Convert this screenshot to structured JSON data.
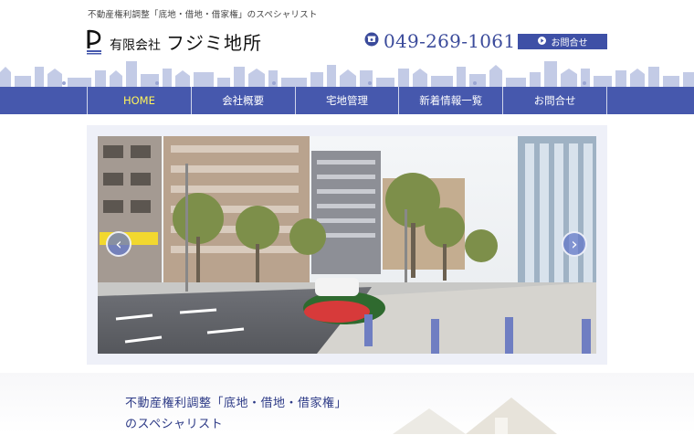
{
  "header": {
    "tagline": "不動産権利調整「底地・借地・借家権」のスペシャリスト",
    "company_kind": "有限会社",
    "company_name": "フジミ地所",
    "phone": "049-269-1061",
    "contact_button": "お問合せ"
  },
  "nav": {
    "items": [
      "HOME",
      "会社概要",
      "宅地管理",
      "新着情報一覧",
      "お問合せ"
    ],
    "active": "HOME"
  },
  "slider": {
    "image_alt": "街並みの写真"
  },
  "intro": {
    "line1": "不動産権利調整「底地・借地・借家権」",
    "line2": "のスペシャリスト"
  },
  "colors": {
    "brand": "#4658ad",
    "active_nav": "#fff45a",
    "text_blue": "#2d3a86"
  }
}
